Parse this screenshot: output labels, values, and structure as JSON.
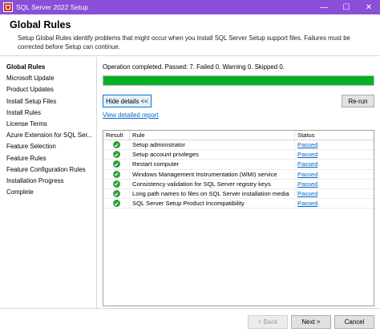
{
  "window": {
    "title": "SQL Server 2022 Setup",
    "minimize_glyph": "—",
    "maximize_glyph": "☐",
    "close_glyph": "✕"
  },
  "header": {
    "title": "Global Rules",
    "description": "Setup Global Rules identify problems that might occur when you install SQL Server Setup support files. Failures must be corrected before Setup can continue."
  },
  "sidebar": {
    "items": [
      {
        "label": "Global Rules",
        "active": true
      },
      {
        "label": "Microsoft Update"
      },
      {
        "label": "Product Updates"
      },
      {
        "label": "Install Setup Files"
      },
      {
        "label": "Install Rules"
      },
      {
        "label": "License Terms"
      },
      {
        "label": "Azure Extension for SQL Ser..."
      },
      {
        "label": "Feature Selection"
      },
      {
        "label": "Feature Rules"
      },
      {
        "label": "Feature Configuration Rules"
      },
      {
        "label": "Installation Progress"
      },
      {
        "label": "Complete"
      }
    ]
  },
  "main": {
    "status_text": "Operation completed. Passed: 7.   Failed 0.   Warning 0.   Skipped 0.",
    "progress": 1.0,
    "progress_color": "#06b025",
    "hide_details_label": "Hide details <<",
    "rerun_label": "Re-run",
    "report_link": "View detailed report",
    "table": {
      "headers": {
        "result": "Result",
        "rule": "Rule",
        "status": "Status"
      },
      "rows": [
        {
          "rule": "Setup administrator",
          "status": "Passed"
        },
        {
          "rule": "Setup account privileges",
          "status": "Passed"
        },
        {
          "rule": "Restart computer",
          "status": "Passed"
        },
        {
          "rule": "Windows Management Instrumentation (WMI) service",
          "status": "Passed"
        },
        {
          "rule": "Consistency validation for SQL Server registry keys",
          "status": "Passed"
        },
        {
          "rule": "Long path names to files on SQL Server installation media",
          "status": "Passed"
        },
        {
          "rule": "SQL Server Setup Product Incompatibility",
          "status": "Passed"
        }
      ]
    }
  },
  "footer": {
    "back_label": "< Back",
    "next_label": "Next >",
    "cancel_label": "Cancel"
  },
  "colors": {
    "titlebar": "#8a4fd8",
    "link": "#0066cc",
    "pass_icon": "#2e9d3a"
  },
  "icons": {
    "app": "sql-server-setup-icon",
    "pass": "green-check-icon"
  }
}
